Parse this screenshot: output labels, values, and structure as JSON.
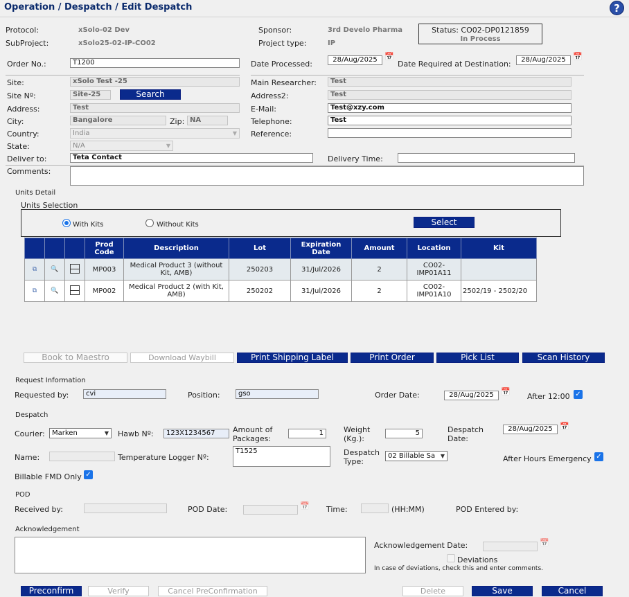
{
  "header": {
    "title": "Operation / Despatch / Edit Despatch",
    "help_icon": "question-circle-icon"
  },
  "protocol": {
    "label": "Protocol:",
    "value": "xSolo-02 Dev"
  },
  "subproject": {
    "label": "SubProject:",
    "value": "xSolo25-02-IP-CO02"
  },
  "sponsor": {
    "label": "Sponsor:",
    "value": "3rd Develo Pharma"
  },
  "project_type": {
    "label": "Project type:",
    "value": "IP"
  },
  "status": {
    "label": "Status:",
    "code": "CO02-DP0121859",
    "state": "In Process"
  },
  "order_no": {
    "label": "Order No.:",
    "value": "T1200"
  },
  "date_processed": {
    "label": "Date Processed:",
    "value": "28/Aug/2025"
  },
  "date_required": {
    "label": "Date Required at Destination:",
    "value": "28/Aug/2025"
  },
  "site": {
    "label": "Site:",
    "value": "xSolo Test -25"
  },
  "site_no": {
    "label": "Site Nº:",
    "value": "Site-25",
    "search_label": "Search"
  },
  "address": {
    "label": "Address:",
    "value": "Test"
  },
  "city": {
    "label": "City:",
    "value": "Bangalore"
  },
  "zip": {
    "label": "Zip:",
    "value": "NA"
  },
  "country": {
    "label": "Country:",
    "value": "India"
  },
  "state": {
    "label": "State:",
    "value": "N/A"
  },
  "deliver_to": {
    "label": "Deliver to:",
    "value": "Teta Contact"
  },
  "main_researcher": {
    "label": "Main Researcher:",
    "value": "Test"
  },
  "address2": {
    "label": "Address2:",
    "value": "Test"
  },
  "email": {
    "label": "E-Mail:",
    "value": "Test@xzy.com"
  },
  "telephone": {
    "label": "Telephone:",
    "value": "Test"
  },
  "reference": {
    "label": "Reference:",
    "value": ""
  },
  "delivery_time": {
    "label": "Delivery Time:",
    "value": ""
  },
  "comments": {
    "label": "Comments:",
    "value": ""
  },
  "units": {
    "section_title": "Units Detail",
    "selection_title": "Units Selection",
    "with_kits": "With Kits",
    "without_kits": "Without Kits",
    "select_label": "Select",
    "columns": [
      "Prod Code",
      "Description",
      "Lot",
      "Expiration Date",
      "Amount",
      "Location",
      "Kit"
    ],
    "rows": [
      {
        "prod_code": "MP003",
        "description": "Medical Product 3 (without Kit, AMB)",
        "lot": "250203",
        "expiration": "31/Jul/2026",
        "amount": "2",
        "location": "CO02-IMP01A11",
        "kit": ""
      },
      {
        "prod_code": "MP002",
        "description": "Medical Product 2 (with Kit, AMB)",
        "lot": "250202",
        "expiration": "31/Jul/2026",
        "amount": "2",
        "location": "CO02-IMP01A10",
        "kit": "2502/19 - 2502/20"
      }
    ]
  },
  "actions": {
    "book_maestro": "Book to Maestro",
    "download_waybill": "Download Waybill",
    "print_shipping_label": "Print Shipping Label",
    "print_order": "Print Order",
    "pick_list": "Pick List",
    "scan_history": "Scan History"
  },
  "request": {
    "section_title": "Request Information",
    "requested_by_label": "Requested by:",
    "requested_by": "cvi",
    "position_label": "Position:",
    "position": "gso",
    "order_date_label": "Order Date:",
    "order_date": "28/Aug/2025",
    "after_12_label": "After 12:00"
  },
  "despatch": {
    "section_title": "Despatch",
    "courier_label": "Courier:",
    "courier": "Marken",
    "hawb_label": "Hawb Nº:",
    "hawb": "123X1234567",
    "amount_packages_label": "Amount of Packages:",
    "amount_packages": "1",
    "weight_label": "Weight (Kg.):",
    "weight": "5",
    "despatch_date_label": "Despatch Date:",
    "despatch_date": "28/Aug/2025",
    "name_label": "Name:",
    "name": "",
    "temp_logger_label": "Temperature Logger Nº:",
    "temp_logger": "T1525",
    "despatch_type_label": "Despatch Type:",
    "despatch_type": "02 Billable Sa",
    "after_hours_label": "After Hours Emergency",
    "billable_fmd_label": "Billable FMD Only"
  },
  "pod": {
    "section_title": "POD",
    "received_by_label": "Received by:",
    "pod_date_label": "POD Date:",
    "time_label": "Time:",
    "time_hint": "(HH:MM)",
    "entered_by_label": "POD Entered by:"
  },
  "ack": {
    "section_title": "Acknowledgement",
    "date_label": "Acknowledgement Date:",
    "deviations_label": "Deviations",
    "deviations_hint": "In case of deviations, check this and enter comments."
  },
  "footer": {
    "preconfirm": "Preconfirm",
    "verify": "Verify",
    "cancel_preconfirmation": "Cancel PreConfirmation",
    "delete": "Delete",
    "save": "Save",
    "cancel": "Cancel"
  }
}
